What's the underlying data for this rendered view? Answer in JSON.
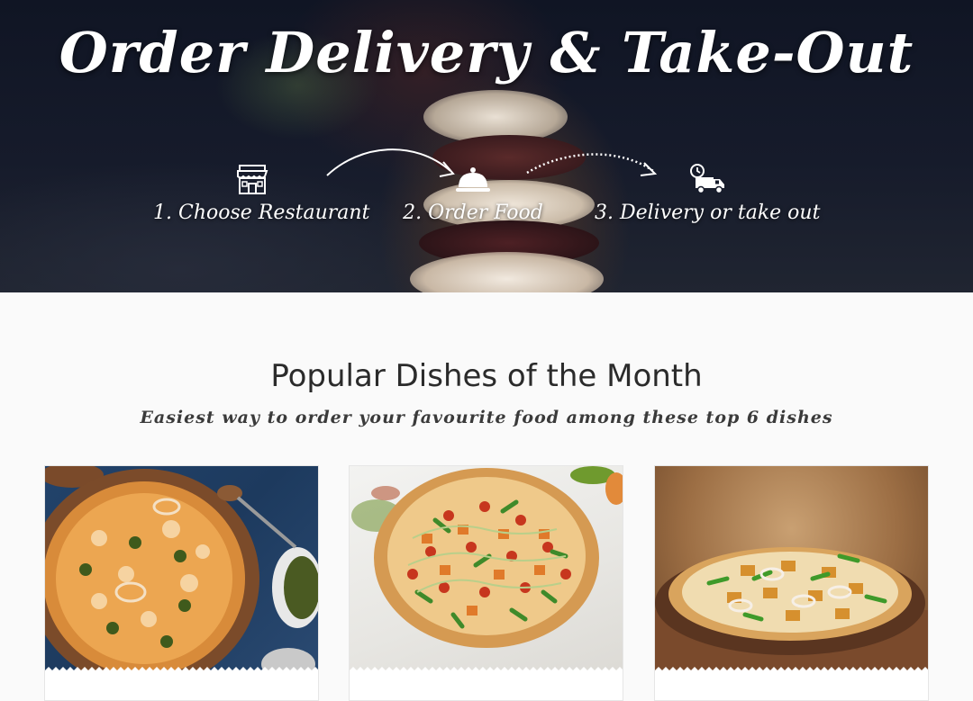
{
  "hero": {
    "title": "Order Delivery & Take-Out",
    "steps": [
      {
        "label": "1. Choose Restaurant",
        "icon": "storefront-icon"
      },
      {
        "label": "2. Order Food",
        "icon": "serving-cloche-icon"
      },
      {
        "label": "3. Delivery or take out",
        "icon": "delivery-truck-icon"
      }
    ]
  },
  "popular": {
    "title": "Popular Dishes of the Month",
    "subtitle": "Easiest way to order your favourite food among these top 6 dishes"
  },
  "dishes": [
    {
      "image": "paneer-jalapeno-pizza-photo"
    },
    {
      "image": "paneer-capsicum-pizza-photo"
    },
    {
      "image": "paneer-onion-pizza-photo"
    }
  ],
  "colors": {
    "hero_bg": "#151a2a",
    "page_bg": "#fafafa",
    "title_text": "#2b2b2b",
    "card_border": "#e6e6e6"
  }
}
